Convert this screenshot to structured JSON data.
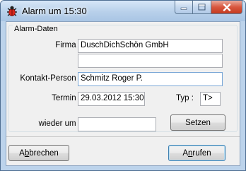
{
  "window": {
    "title": "Alarm um 15:30",
    "icon": "bug-icon",
    "controls": {
      "minimize": "minimize-icon",
      "maximize": "maximize-icon",
      "close": "close-icon"
    }
  },
  "group": {
    "title": "Alarm-Daten"
  },
  "form": {
    "firma_label": "Firma :",
    "firma_value": "DuschDichSchön GmbH",
    "firma2_value": "",
    "kontakt_label": "Kontakt-Person :",
    "kontakt_value": "Schmitz Roger P.",
    "termin_label": "Termin :",
    "termin_value": "29.03.2012 15:30",
    "typ_label": "Typ :",
    "typ_value": "T>",
    "wieder_label": "wieder um :",
    "wieder_value": "",
    "setzen_button": "Setzen"
  },
  "footer": {
    "abbrechen_button": "Abbrechen",
    "abbrechen_accel": "b",
    "anrufen_button": "Anrufen",
    "anrufen_accel": "n"
  },
  "colors": {
    "close_button": "#c43a1f",
    "title_bar": "#b8d0ea"
  }
}
